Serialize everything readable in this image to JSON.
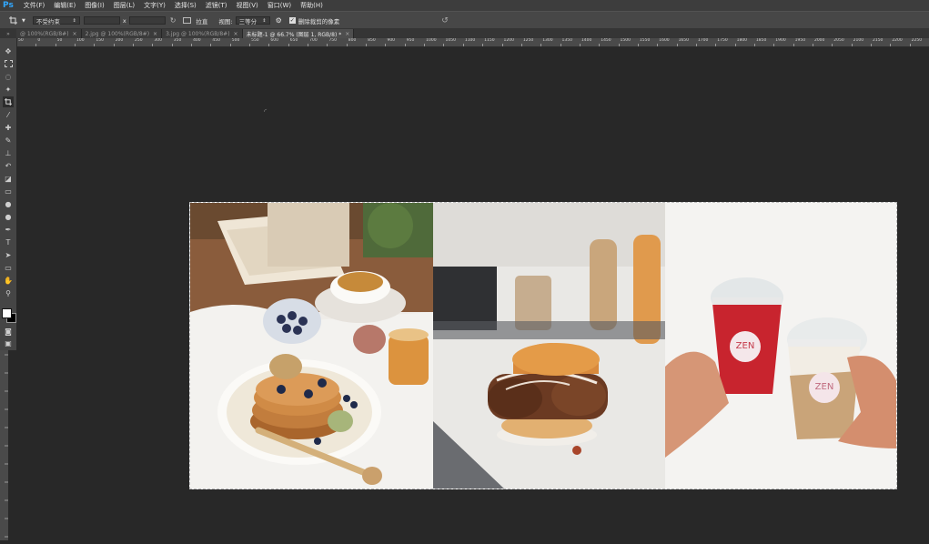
{
  "menubar": {
    "app_logo": "Ps",
    "items": [
      "文件(F)",
      "编辑(E)",
      "图像(I)",
      "图层(L)",
      "文字(Y)",
      "选择(S)",
      "滤镜(T)",
      "视图(V)",
      "窗口(W)",
      "帮助(H)"
    ]
  },
  "options": {
    "ratio_value": "不受约束",
    "times": "x",
    "straighten_label": "拉直",
    "view_label": "视图:",
    "view_value": "三等分",
    "delete_cropped_label": "删除裁剪的像素",
    "delete_cropped_checked": true
  },
  "tabs": [
    {
      "label": "@ 100%(RGB/8#)",
      "active": false
    },
    {
      "label": "2.jpg @ 100%(RGB/8#)",
      "active": false
    },
    {
      "label": "3.jpg @ 100%(RGB/8#)",
      "active": false
    },
    {
      "label": "未标题-1 @ 66.7% (图层 1, RGB/8) *",
      "active": true
    }
  ],
  "ruler": {
    "labels": [
      "50",
      "0",
      "50",
      "100",
      "150",
      "200",
      "250",
      "300",
      "350",
      "400",
      "450",
      "500",
      "550",
      "600",
      "650",
      "700",
      "750",
      "800",
      "850",
      "900",
      "950",
      "1000",
      "1050",
      "1100",
      "1150",
      "1200",
      "1250",
      "1300",
      "1350",
      "1400",
      "1450",
      "1500",
      "1550",
      "1600",
      "1650",
      "1700",
      "1750",
      "1800",
      "1850",
      "1900",
      "1950",
      "2000",
      "2050",
      "2100",
      "2150",
      "2200",
      "2250"
    ]
  },
  "colors": {
    "foreground": "#ffffff",
    "background": "#000000"
  },
  "document": {
    "panels": [
      "breakfast-photo",
      "burger-photo",
      "drinks-photo"
    ],
    "cup_logo_text": "ZEN"
  }
}
